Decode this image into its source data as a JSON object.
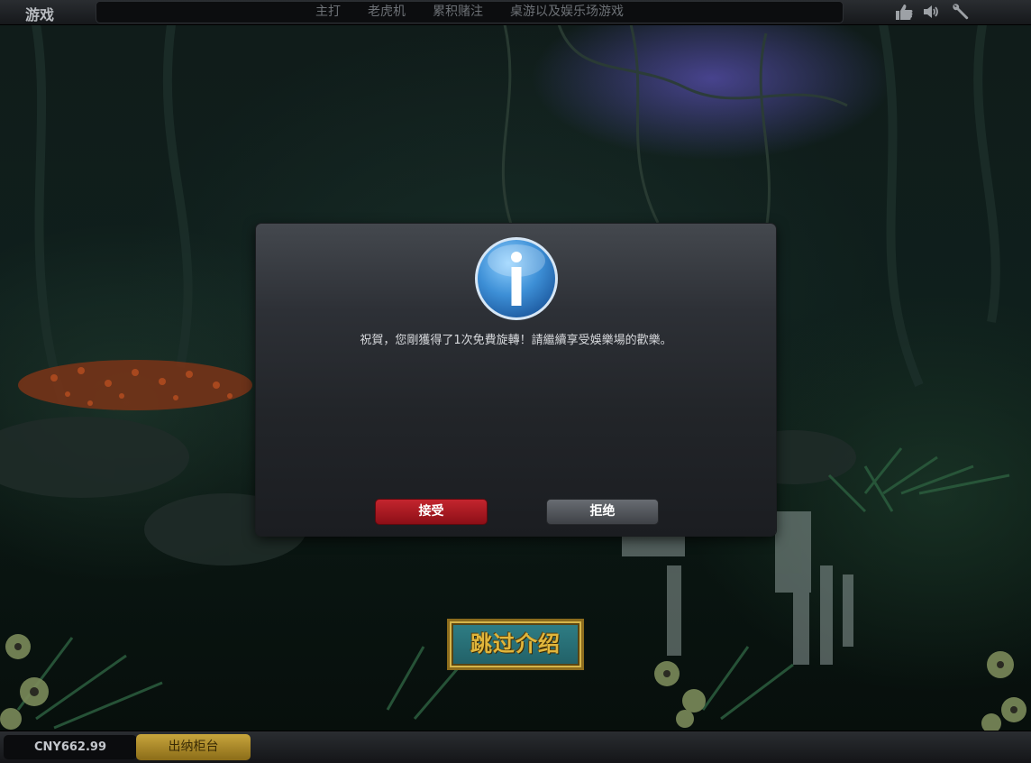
{
  "topbar": {
    "games_title": "游戏",
    "nav": [
      "主打",
      "老虎机",
      "累积赌注",
      "桌游以及娱乐场游戏"
    ],
    "icons": [
      "thumbs-up-icon",
      "speaker-icon",
      "wrench-icon"
    ]
  },
  "dialog": {
    "icon": "info-icon",
    "message": "祝賀，您剛獲得了1次免費旋轉！請繼續享受娛樂場的歡樂。",
    "accept_label": "接受",
    "decline_label": "拒绝"
  },
  "skip_intro_label": "跳过介绍",
  "bottombar": {
    "balance": "CNY662.99",
    "cashier_label": "出纳柜台"
  },
  "colors": {
    "accept": "#b31c25",
    "decline": "#55585e",
    "cashier": "#b89530",
    "skip_text": "#e0b63c"
  }
}
